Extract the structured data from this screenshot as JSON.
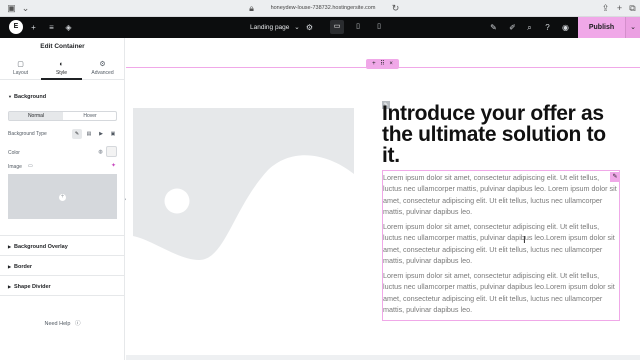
{
  "browser": {
    "url": "honeydew-louse-738732.hostingersite.com"
  },
  "topbar": {
    "page_name": "Landing page",
    "page_caret": "⌄",
    "publish_label": "Publish"
  },
  "panel": {
    "title": "Edit Container",
    "tabs": [
      {
        "label": "Layout",
        "icon": "layout-icon"
      },
      {
        "label": "Style",
        "icon": "style-icon"
      },
      {
        "label": "Advanced",
        "icon": "advanced-icon"
      }
    ],
    "active_tab": "Style",
    "sections": {
      "background": "Background",
      "background_overlay": "Background Overlay",
      "border": "Border",
      "shape_divider": "Shape Divider"
    },
    "state_tabs": [
      "Normal",
      "Hover"
    ],
    "labels": {
      "background_type": "Background Type",
      "color": "Color",
      "image": "Image"
    },
    "help": "Need Help"
  },
  "canvas": {
    "heading": "Introduce your offer as the ultimate solution to it.",
    "paragraphs": [
      "Lorem ipsum dolor sit amet, consectetur adipiscing elit. Ut elit tellus, luctus nec ullamcorper mattis, pulvinar dapibus leo. Lorem ipsum dolor sit amet, consectetur adipiscing elit. Ut elit tellus, luctus nec ullamcorper mattis, pulvinar dapibus leo.",
      "Lorem ipsum dolor sit amet, consectetur adipiscing elit. Ut elit tellus, luctus nec ullamcorper mattis, pulvinar dapibus leo.Lorem ipsum dolor sit amet, consectetur adipiscing elit. Ut elit tellus, luctus nec ullamcorper mattis, pulvinar dapibus leo.",
      "Lorem ipsum dolor sit amet, consectetur adipiscing elit. Ut elit tellus, luctus nec ullamcorper mattis, pulvinar dapibus leo.Lorem ipsum dolor sit amet, consectetur adipiscing elit. Ut elit tellus, luctus nec ullamcorper mattis, pulvinar dapibus leo."
    ]
  },
  "colors": {
    "accent": "#f0a8e8",
    "topbar_bg": "#0c0d0e",
    "placeholder_bg": "#e6e8ea",
    "placeholder_shape": "#ffffff"
  }
}
